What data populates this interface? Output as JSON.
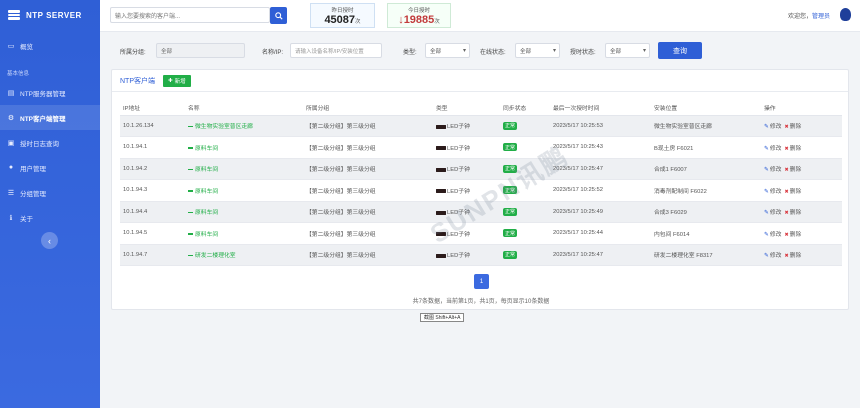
{
  "app": {
    "title": "NTP SERVER"
  },
  "sidebar": {
    "items": [
      {
        "label": "概览",
        "icon": "monitor-icon"
      },
      {
        "label": "NTP服务器管理",
        "icon": "server-icon"
      },
      {
        "label": "NTP客户端管理",
        "icon": "client-icon"
      },
      {
        "label": "授时日志查询",
        "icon": "log-icon"
      },
      {
        "label": "用户管理",
        "icon": "users-icon"
      },
      {
        "label": "分组管理",
        "icon": "group-icon"
      },
      {
        "label": "关于",
        "icon": "info-icon"
      }
    ],
    "group_label": "基本信息",
    "collapse_icon": "chevron-left-icon"
  },
  "topbar": {
    "search_placeholder": "输入您要搜索的客户端...",
    "stats": [
      {
        "label": "昨日授时",
        "value": "45087",
        "unit": "次"
      },
      {
        "label": "今日授时",
        "value": "19885",
        "unit": "次",
        "arrow": "↓"
      }
    ],
    "welcome": "欢迎您，",
    "username": "管理员"
  },
  "filters": {
    "group_label": "所属分组:",
    "group_value": "全部",
    "name_label": "名称/IP:",
    "name_placeholder": "请输入设备名称/IP/安装位置",
    "type_label": "类型:",
    "type_value": "全部",
    "online_label": "在线状态:",
    "online_value": "全部",
    "sync_label": "授时状态:",
    "sync_value": "全部",
    "query_label": "查询"
  },
  "panel": {
    "title": "NTP客户端",
    "add_label": "新增",
    "columns": [
      "IP地址",
      "名称",
      "所属分组",
      "类型",
      "同步状态",
      "最后一次授时时间",
      "安装位置",
      "操作"
    ],
    "rows": [
      {
        "ip": "10.1.26.134",
        "name": "微生物实验室普区走廊",
        "group": "【第二级分组】第三级分组",
        "type": "LED子钟",
        "status": "正常",
        "time": "2023/5/17 10:25:53",
        "location": "微生物实验室普区走廊"
      },
      {
        "ip": "10.1.94.1",
        "name": "原料车间",
        "group": "【第二级分组】第三级分组",
        "type": "LED子钟",
        "status": "正常",
        "time": "2023/5/17 10:25:43",
        "location": "B现土房 F6021"
      },
      {
        "ip": "10.1.94.2",
        "name": "原料车间",
        "group": "【第二级分组】第三级分组",
        "type": "LED子钟",
        "status": "正常",
        "time": "2023/5/17 10:25:47",
        "location": "合成1 F6007"
      },
      {
        "ip": "10.1.94.3",
        "name": "原料车间",
        "group": "【第二级分组】第三级分组",
        "type": "LED子钟",
        "status": "正常",
        "time": "2023/5/17 10:25:52",
        "location": "消毒剂配制间 F6022"
      },
      {
        "ip": "10.1.94.4",
        "name": "原料车间",
        "group": "【第二级分组】第三级分组",
        "type": "LED子钟",
        "status": "正常",
        "time": "2023/5/17 10:25:49",
        "location": "合成3 F6029"
      },
      {
        "ip": "10.1.94.5",
        "name": "原料车间",
        "group": "【第二级分组】第三级分组",
        "type": "LED子钟",
        "status": "正常",
        "time": "2023/5/17 10:25:44",
        "location": "内包间 F6014"
      },
      {
        "ip": "10.1.94.7",
        "name": "研发二楼理化室",
        "group": "【第二级分组】第三级分组",
        "type": "LED子钟",
        "status": "正常",
        "time": "2023/5/17 10:25:47",
        "location": "研发二楼理化室 F8317"
      }
    ],
    "edit_label": "修改",
    "delete_label": "删除",
    "page": "1",
    "pager_info": "共7条数据，当前第1页，共1页，每页显示10条数据"
  },
  "tooltip": "截图 Shift+Alt+A",
  "watermark": "SUNPN讯鹏",
  "colors": {
    "primary": "#2f5fd6",
    "success": "#21ae47",
    "danger": "#d9363e"
  }
}
